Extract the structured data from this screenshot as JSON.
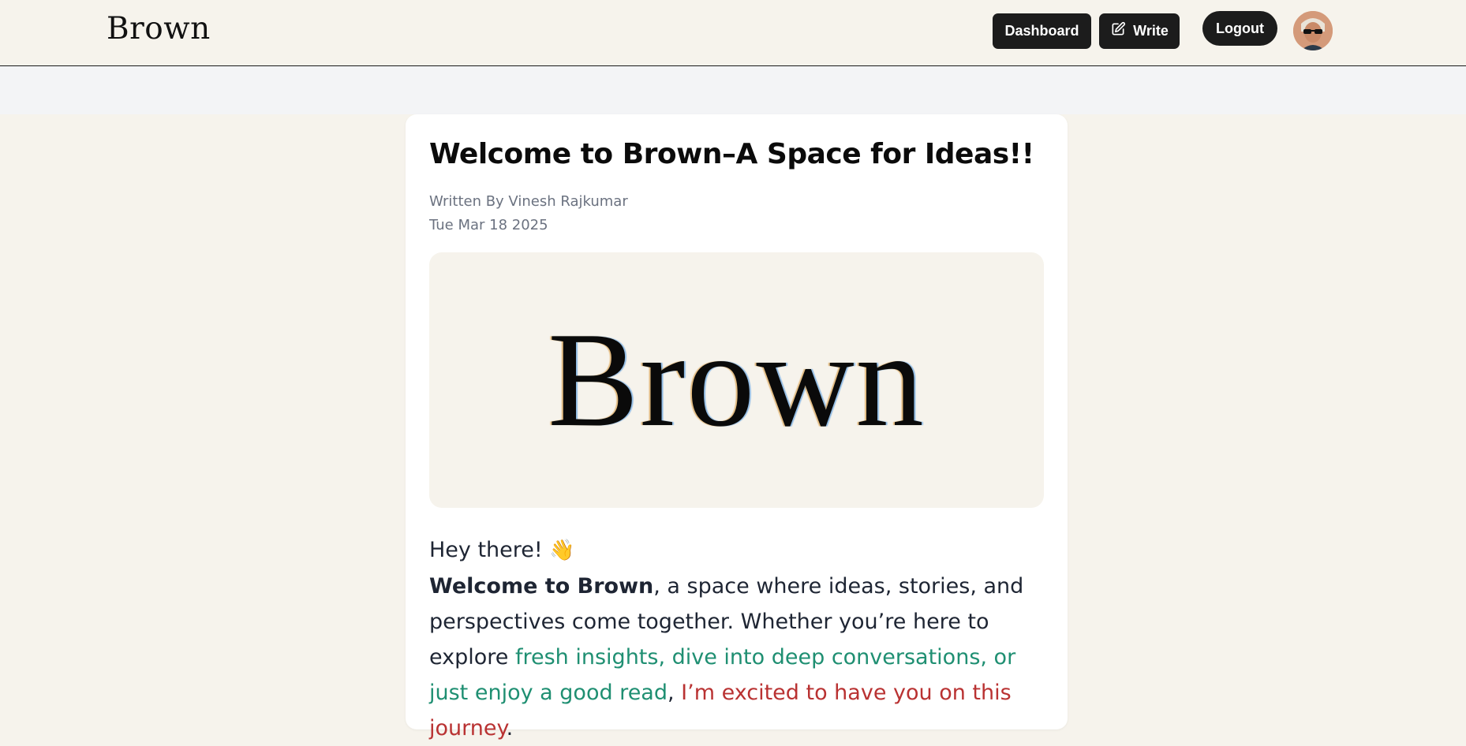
{
  "header": {
    "logo": "Brown",
    "nav": {
      "dashboard_label": "Dashboard",
      "write_label": "Write",
      "logout_label": "Logout"
    },
    "avatar_icon": "user-avatar"
  },
  "article": {
    "title": "Welcome to Brown–A Space for Ideas!!",
    "author_line": "Written By Vinesh Rajkumar",
    "date": "Tue Mar 18 2025",
    "cover_image_text": "Brown",
    "greeting": "Hey there!",
    "greeting_emoji": "👋",
    "para": {
      "strong": "Welcome to Brown",
      "text1": ", a space where ideas, stories, and perspectives come together. Whether you’re here to explore ",
      "green": "fresh insights, dive into deep conversations, or just enjoy a good read",
      "text2": ", ",
      "red": "I’m excited to have you on this journey",
      "text3": "."
    }
  },
  "colors": {
    "page_bg": "#f6f3ec",
    "button_bg": "#1c1c1c",
    "accent_green": "#1f8f72",
    "accent_red": "#b93232"
  }
}
